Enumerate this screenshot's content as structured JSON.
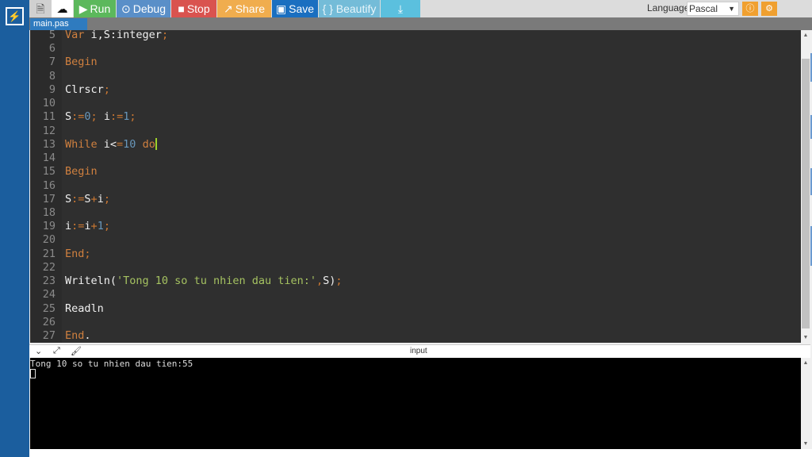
{
  "app": {
    "logo_icon": "bolt-icon"
  },
  "toolbar": {
    "new_file_icon": "file-icon",
    "upload_icon": "cloud-upload-icon",
    "run": "Run",
    "debug": "Debug",
    "stop": "Stop",
    "share": "Share",
    "save": "Save",
    "beautify": "{ } Beautify",
    "download_icon": "download-icon",
    "language_label": "Language",
    "language_value": "Pascal",
    "colors": {
      "run": "#5cb85c",
      "debug": "#5a8fc8",
      "stop": "#d9534f",
      "share": "#f0ad4e",
      "save": "#1a6fc0",
      "beautify": "#74bcd8",
      "download": "#5bc0de"
    }
  },
  "tab": {
    "label": "main.pas"
  },
  "editor": {
    "lines": [
      {
        "n": "5",
        "tokens": [
          [
            "Var",
            "kw"
          ],
          [
            " i,S:integer",
            "id"
          ],
          [
            ";",
            "pn"
          ]
        ]
      },
      {
        "n": "6",
        "tokens": []
      },
      {
        "n": "7",
        "tokens": [
          [
            "Begin",
            "kw"
          ]
        ]
      },
      {
        "n": "8",
        "tokens": []
      },
      {
        "n": "9",
        "tokens": [
          [
            "Clrscr",
            "id"
          ],
          [
            ";",
            "pn"
          ]
        ]
      },
      {
        "n": "10",
        "tokens": []
      },
      {
        "n": "11",
        "tokens": [
          [
            "S",
            "id"
          ],
          [
            ":=",
            "pn"
          ],
          [
            "0",
            "nm"
          ],
          [
            ";",
            "pn"
          ],
          [
            " i",
            "id"
          ],
          [
            ":=",
            "pn"
          ],
          [
            "1",
            "nm"
          ],
          [
            ";",
            "pn"
          ]
        ]
      },
      {
        "n": "12",
        "tokens": []
      },
      {
        "n": "13",
        "tokens": [
          [
            "While",
            "kw"
          ],
          [
            " i<",
            "id"
          ],
          [
            "=",
            "pn"
          ],
          [
            "10",
            "nm"
          ],
          [
            " ",
            "id"
          ],
          [
            "do",
            "kw"
          ]
        ],
        "cursor": true
      },
      {
        "n": "14",
        "tokens": []
      },
      {
        "n": "15",
        "tokens": [
          [
            "Begin",
            "kw"
          ]
        ]
      },
      {
        "n": "16",
        "tokens": []
      },
      {
        "n": "17",
        "tokens": [
          [
            "S",
            "id"
          ],
          [
            ":=",
            "pn"
          ],
          [
            "S",
            "id"
          ],
          [
            "+",
            "pn"
          ],
          [
            "i",
            "id"
          ],
          [
            ";",
            "pn"
          ]
        ]
      },
      {
        "n": "18",
        "tokens": []
      },
      {
        "n": "19",
        "tokens": [
          [
            "i",
            "id"
          ],
          [
            ":=",
            "pn"
          ],
          [
            "i",
            "id"
          ],
          [
            "+",
            "pn"
          ],
          [
            "1",
            "nm"
          ],
          [
            ";",
            "pn"
          ]
        ]
      },
      {
        "n": "20",
        "tokens": []
      },
      {
        "n": "21",
        "tokens": [
          [
            "End",
            "kw"
          ],
          [
            ";",
            "pn"
          ]
        ]
      },
      {
        "n": "22",
        "tokens": []
      },
      {
        "n": "23",
        "tokens": [
          [
            "Writeln(",
            "id"
          ],
          [
            "'Tong 10 so tu nhien dau tien:'",
            "st"
          ],
          [
            ",",
            "pn"
          ],
          [
            "S)",
            "id"
          ],
          [
            ";",
            "pn"
          ]
        ]
      },
      {
        "n": "24",
        "tokens": []
      },
      {
        "n": "25",
        "tokens": [
          [
            "Readln",
            "id"
          ]
        ]
      },
      {
        "n": "26",
        "tokens": []
      },
      {
        "n": "27",
        "tokens": [
          [
            "End",
            "kw"
          ],
          [
            ".",
            "id"
          ]
        ]
      }
    ]
  },
  "output": {
    "title": "input",
    "collapse_icon": "chevron-down-icon",
    "expand_icon": "expand-icon",
    "clear_icon": "clear-icon",
    "text": "Tong 10 so tu nhien dau tien:55"
  }
}
